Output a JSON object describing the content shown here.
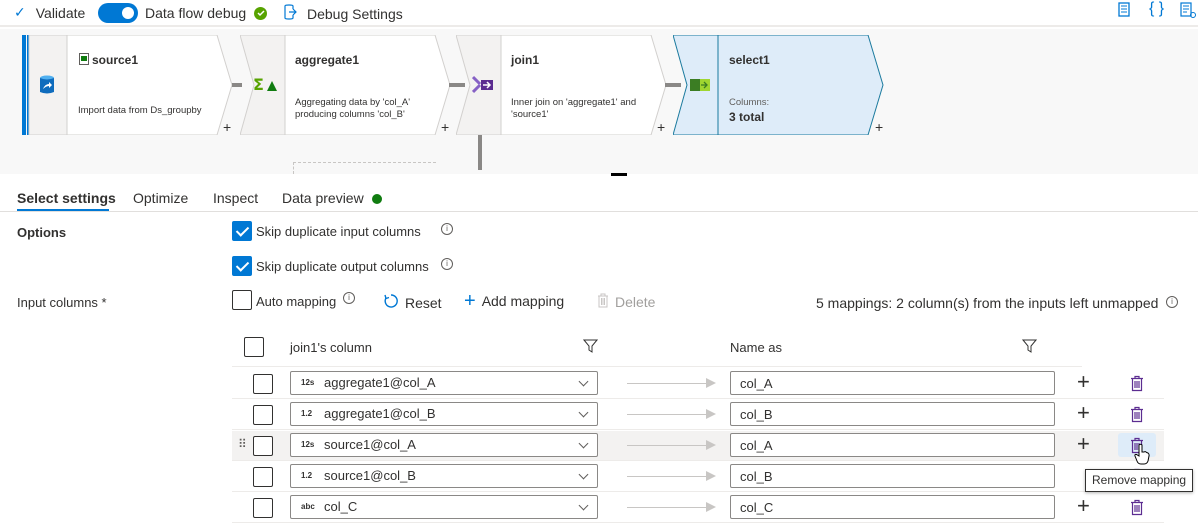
{
  "toolbar": {
    "validate_label": "Validate",
    "debug_label": "Data flow debug",
    "debug_enabled": true,
    "debug_settings_label": "Debug Settings",
    "right_icons": [
      "script-icon",
      "code-icon",
      "properties-icon"
    ]
  },
  "canvas": {
    "nodes": [
      {
        "name": "source1",
        "description": "Import data from Ds_groupby",
        "icon": "source-icon"
      },
      {
        "name": "aggregate1",
        "description_line1": "Aggregating data by 'col_A'",
        "description_line2": "producing columns 'col_B'",
        "icon": "aggregate-icon"
      },
      {
        "name": "join1",
        "description_line1": "Inner join on 'aggregate1' and",
        "description_line2": "'source1'",
        "icon": "join-icon"
      },
      {
        "name": "select1",
        "columns_label": "Columns:",
        "columns_value": "3 total",
        "icon": "select-icon",
        "selected": true
      }
    ],
    "add_symbol": "+"
  },
  "tabs": [
    {
      "label": "Select settings",
      "active": true
    },
    {
      "label": "Optimize",
      "active": false
    },
    {
      "label": "Inspect",
      "active": false
    },
    {
      "label": "Data preview",
      "active": false,
      "status": "green"
    }
  ],
  "options": {
    "label": "Options",
    "skip_input": {
      "label": "Skip duplicate input columns",
      "checked": true
    },
    "skip_output": {
      "label": "Skip duplicate output columns",
      "checked": true
    }
  },
  "input_columns": {
    "label": "Input columns *",
    "auto_mapping": {
      "label": "Auto mapping",
      "checked": false
    },
    "reset_label": "Reset",
    "add_mapping_label": "Add mapping",
    "delete_label": "Delete",
    "summary": "5 mappings: 2 column(s) from the inputs left unmapped",
    "headers": {
      "source": "join1's column",
      "target": "Name as"
    },
    "rows": [
      {
        "type": "12s",
        "source": "aggregate1@col_A",
        "target": "col_A"
      },
      {
        "type": "1.2",
        "source": "aggregate1@col_B",
        "target": "col_B"
      },
      {
        "type": "12s",
        "source": "source1@col_A",
        "target": "col_A"
      },
      {
        "type": "1.2",
        "source": "source1@col_B",
        "target": "col_B"
      },
      {
        "type": "abc",
        "source": "col_C",
        "target": "col_C"
      }
    ]
  },
  "tooltip": "Remove mapping",
  "colors": {
    "accent": "#0078d4",
    "selected_node": "#deecf9",
    "success": "#57a300",
    "delete_icon": "#5c2d91"
  }
}
